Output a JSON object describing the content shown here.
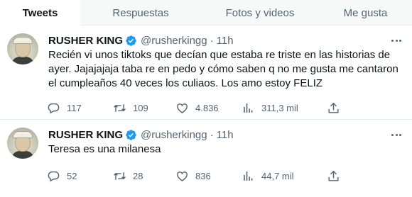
{
  "tabs": [
    {
      "label": "Tweets",
      "active": true
    },
    {
      "label": "Respuestas",
      "active": false
    },
    {
      "label": "Fotos y videos",
      "active": false
    },
    {
      "label": "Me gusta",
      "active": false
    }
  ],
  "tweets": [
    {
      "name": "RUSHER KING",
      "handle": "@rusherkingg",
      "separator": "·",
      "time": "11h",
      "text": "Recién vi unos tiktoks que decían que estaba re triste en las historias de ayer. Jajajajaja taba re en pedo y cómo saben q no me gusta me cantaron el cumpleaños 40 veces los culiaos. Los amo estoy FELIZ",
      "replies": "117",
      "retweets": "109",
      "likes": "4.836",
      "views": "311,3 mil"
    },
    {
      "name": "RUSHER KING",
      "handle": "@rusherkingg",
      "separator": "·",
      "time": "11h",
      "text": "Teresa es una milanesa",
      "replies": "52",
      "retweets": "28",
      "likes": "836",
      "views": "44,7 mil"
    }
  ],
  "icons": {
    "verified": "verified-badge-icon",
    "more": "more-horizontal-icon",
    "reply": "reply-bubble-icon",
    "retweet": "retweet-arrows-icon",
    "like": "heart-icon",
    "views": "views-bar-chart-icon",
    "share": "share-upload-icon"
  },
  "colors": {
    "verified": "#1d9bf0",
    "secondary_text": "#536471",
    "primary_text": "#0f1419",
    "divider": "#e6ecf0",
    "tab_bar_bg": "#f7f9f9"
  }
}
